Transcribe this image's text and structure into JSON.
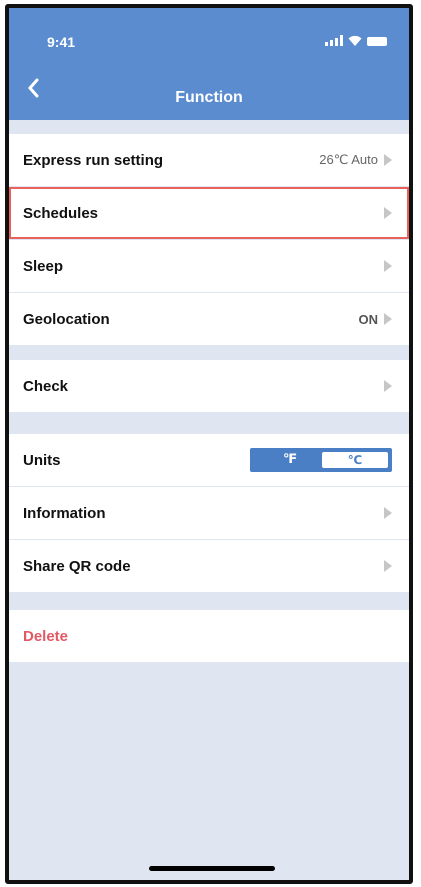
{
  "status_bar": {
    "time": "9:41"
  },
  "header": {
    "title": "Function"
  },
  "rows": {
    "express_run": {
      "label": "Express run setting",
      "value": "26℃ Auto"
    },
    "schedules": {
      "label": "Schedules"
    },
    "sleep": {
      "label": "Sleep"
    },
    "geolocation": {
      "label": "Geolocation",
      "value": "ON"
    },
    "check": {
      "label": "Check"
    },
    "units": {
      "label": "Units",
      "option_f": "℉",
      "option_c": "℃",
      "selected": "℃"
    },
    "information": {
      "label": "Information"
    },
    "share_qr": {
      "label": "Share QR code"
    },
    "delete": {
      "label": "Delete"
    }
  },
  "colors": {
    "header": "#5a8ccf",
    "background": "#dfe6f1",
    "highlight_border": "#e7625c",
    "delete_text": "#e05a66",
    "toggle": "#4a7fc5"
  }
}
